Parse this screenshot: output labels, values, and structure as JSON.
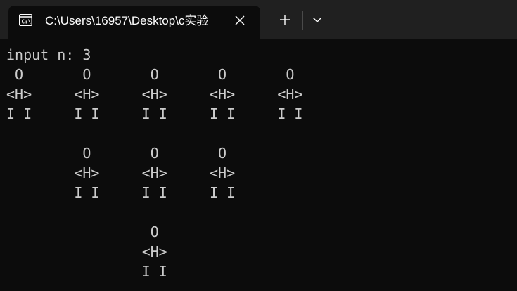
{
  "tab": {
    "title": "C:\\Users\\16957\\Desktop\\c实验",
    "icon": "terminal-icon"
  },
  "controls": {
    "close_icon": "close-icon",
    "new_tab_icon": "plus-icon",
    "dropdown_icon": "chevron-down-icon"
  },
  "terminal": {
    "lines": [
      "input n: 3",
      " O       O       O       O       O",
      "<H>     <H>     <H>     <H>     <H>",
      "I I     I I     I I     I I     I I",
      "",
      "         O       O       O",
      "        <H>     <H>     <H>",
      "        I I     I I     I I",
      "",
      "                 O",
      "                <H>",
      "                I I"
    ]
  }
}
